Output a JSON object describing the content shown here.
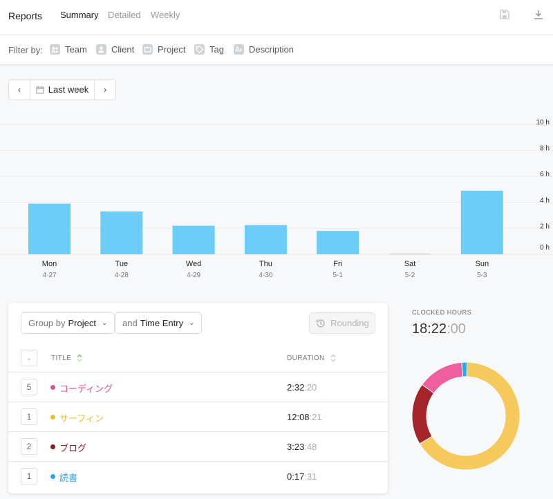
{
  "header": {
    "title": "Reports",
    "tabs": [
      {
        "label": "Summary",
        "active": true
      },
      {
        "label": "Detailed",
        "active": false
      },
      {
        "label": "Weekly",
        "active": false
      }
    ],
    "icons": [
      "save-icon",
      "download-icon"
    ]
  },
  "filters": {
    "label": "Filter by:",
    "items": [
      {
        "label": "Team",
        "icon": "team-icon"
      },
      {
        "label": "Client",
        "icon": "client-icon"
      },
      {
        "label": "Project",
        "icon": "project-icon"
      },
      {
        "label": "Tag",
        "icon": "tag-icon"
      },
      {
        "label": "Description",
        "icon": "description-icon"
      }
    ]
  },
  "date_range": {
    "prev": "‹",
    "label": "Last week",
    "next": "›"
  },
  "chart_data": {
    "type": "bar",
    "categories": [
      "Mon",
      "Tue",
      "Wed",
      "Thu",
      "Fri",
      "Sat",
      "Sun"
    ],
    "sublabels": [
      "4-27",
      "4-28",
      "4-29",
      "4-30",
      "5-1",
      "5-2",
      "5-3"
    ],
    "values": [
      3.9,
      3.3,
      2.2,
      2.25,
      1.8,
      0.05,
      4.9
    ],
    "y_ticks": [
      "10 h",
      "8 h",
      "6 h",
      "4 h",
      "2 h",
      "0 h"
    ],
    "ylim": [
      0,
      10
    ],
    "grid": true,
    "bar_color": "#6ccdf8"
  },
  "table": {
    "group_by": {
      "prefix": "Group by",
      "value": "Project"
    },
    "and_by": {
      "prefix": "and",
      "value": "Time Entry"
    },
    "rounding_label": "Rounding",
    "columns": {
      "title": "TITLE",
      "duration": "DURATION"
    },
    "rows": [
      {
        "count": "5",
        "name": "コーディング",
        "color": "#e04f8f",
        "dur_main": "2:32",
        "dur_sec": ":20"
      },
      {
        "count": "1",
        "name": "サーフィン",
        "color": "#e8c12e",
        "dur_main": "12:08",
        "dur_sec": ":21"
      },
      {
        "count": "2",
        "name": "ブログ",
        "color": "#8e1a1a",
        "dur_main": "3:23",
        "dur_sec": ":48"
      },
      {
        "count": "1",
        "name": "読書",
        "color": "#1ea7f2",
        "dur_main": "0:17",
        "dur_sec": ":31"
      }
    ]
  },
  "clocked": {
    "label": "CLOCKED HOURS",
    "value_main": "18:22",
    "value_sec": ":00"
  },
  "donut_data": {
    "type": "pie",
    "slices": [
      {
        "label": "サーフィン",
        "value": 12.14,
        "color": "#f5c95c"
      },
      {
        "label": "ブログ",
        "value": 3.4,
        "color": "#a3252a"
      },
      {
        "label": "コーディング",
        "value": 2.54,
        "color": "#ef5f9e"
      },
      {
        "label": "読書",
        "value": 0.29,
        "color": "#2aa8ee"
      }
    ]
  }
}
